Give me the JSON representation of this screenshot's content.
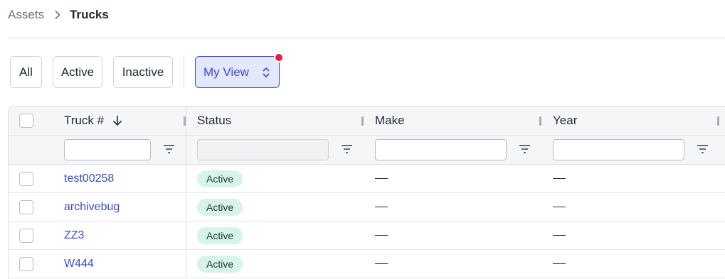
{
  "breadcrumb": {
    "parent": "Assets",
    "current": "Trucks"
  },
  "filters": {
    "all": "All",
    "active": "Active",
    "inactive": "Inactive",
    "view": "My View"
  },
  "table": {
    "columns": {
      "truck": "Truck #",
      "status": "Status",
      "make": "Make",
      "year": "Year"
    },
    "rows": [
      {
        "truck": "test00258",
        "status": "Active",
        "make": "—",
        "year": "—"
      },
      {
        "truck": "archivebug",
        "status": "Active",
        "make": "—",
        "year": "—"
      },
      {
        "truck": "ZZ3",
        "status": "Active",
        "make": "—",
        "year": "—"
      },
      {
        "truck": "W444",
        "status": "Active",
        "make": "—",
        "year": "—"
      }
    ]
  },
  "colors": {
    "accent": "#3b4cd0",
    "accent_bg": "#e3e7ff",
    "notification": "#e11d48",
    "badge_bg": "#d7f3ea",
    "header_bg": "#f5f6f8"
  }
}
